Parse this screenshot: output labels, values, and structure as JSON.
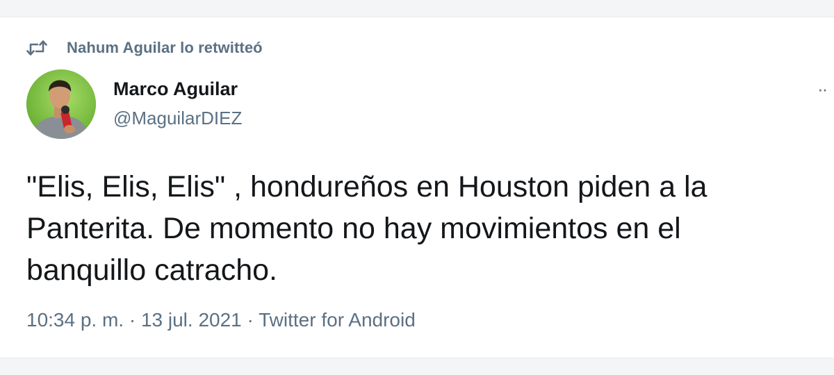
{
  "retweet": {
    "icon": "retweet-icon",
    "label": "Nahum Aguilar lo retwitteó"
  },
  "author": {
    "name": "Marco Aguilar",
    "handle": "@MaguilarDIEZ",
    "avatar_bg": "#7cc242"
  },
  "menu": {
    "icon": "more-options-icon",
    "glyph": "··"
  },
  "tweet": {
    "text": "\"Elis, Elis, Elis\" , hondureños en Houston piden a la\nPanterita. De momento no hay movimientos en el\nbanquillo catracho."
  },
  "meta": {
    "text": "10:34 p. m. · 13 jul. 2021 · Twitter for Android"
  },
  "colors": {
    "primary_text": "#14171a",
    "secondary_text": "#5b7083"
  }
}
